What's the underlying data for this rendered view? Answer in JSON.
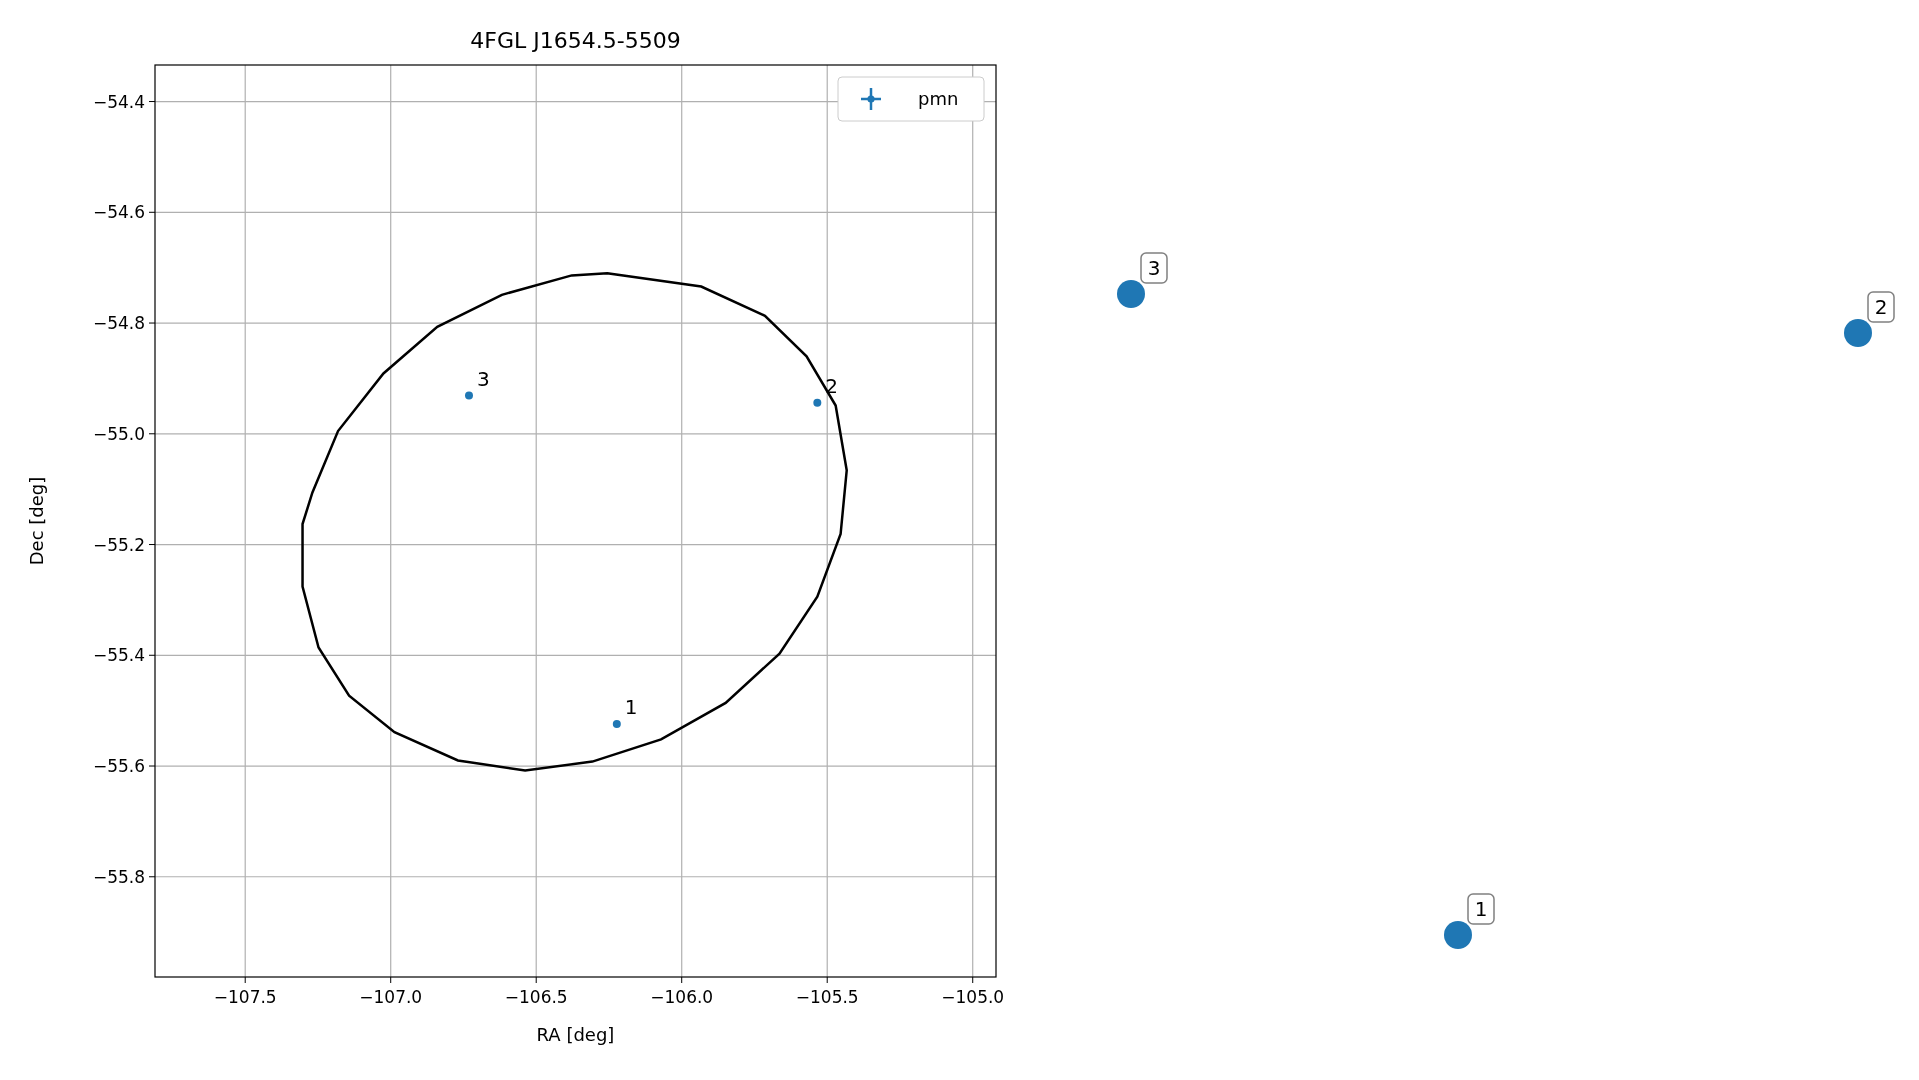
{
  "chart_data": {
    "type": "scatter",
    "title": "4FGL J1654.5-5509",
    "xlabel": "RA [deg]",
    "ylabel": "Dec [deg]",
    "xlim": [
      -107.81,
      -104.92
    ],
    "ylim": [
      -55.981,
      -54.334
    ],
    "grid": true,
    "xticks": [
      {
        "value": -107.5,
        "label": "−107.5"
      },
      {
        "value": -107.0,
        "label": "−107.0"
      },
      {
        "value": -106.5,
        "label": "−106.5"
      },
      {
        "value": -106.0,
        "label": "−106.0"
      },
      {
        "value": -105.5,
        "label": "−105.5"
      },
      {
        "value": -105.0,
        "label": "−105.0"
      }
    ],
    "yticks": [
      {
        "value": -54.4,
        "label": "−54.4"
      },
      {
        "value": -54.6,
        "label": "−54.6"
      },
      {
        "value": -54.8,
        "label": "−54.8"
      },
      {
        "value": -55.0,
        "label": "−55.0"
      },
      {
        "value": -55.2,
        "label": "−55.2"
      },
      {
        "value": -55.4,
        "label": "−55.4"
      },
      {
        "value": -55.6,
        "label": "−55.6"
      },
      {
        "value": -55.8,
        "label": "−55.8"
      }
    ],
    "series": [
      {
        "name": "pmn",
        "color": "#1f77b4",
        "marker": "o",
        "x": [
          -106.223,
          -105.534,
          -106.731
        ],
        "values": [
          -55.524,
          -54.944,
          -54.931
        ]
      }
    ],
    "annotations": [
      {
        "x": -106.223,
        "y": -55.524,
        "text": "1"
      },
      {
        "x": -105.534,
        "y": -54.944,
        "text": "2"
      },
      {
        "x": -106.731,
        "y": -54.931,
        "text": "3"
      }
    ]
  },
  "markers": [
    {
      "label": "3"
    },
    {
      "label": "2"
    },
    {
      "label": "1"
    }
  ]
}
